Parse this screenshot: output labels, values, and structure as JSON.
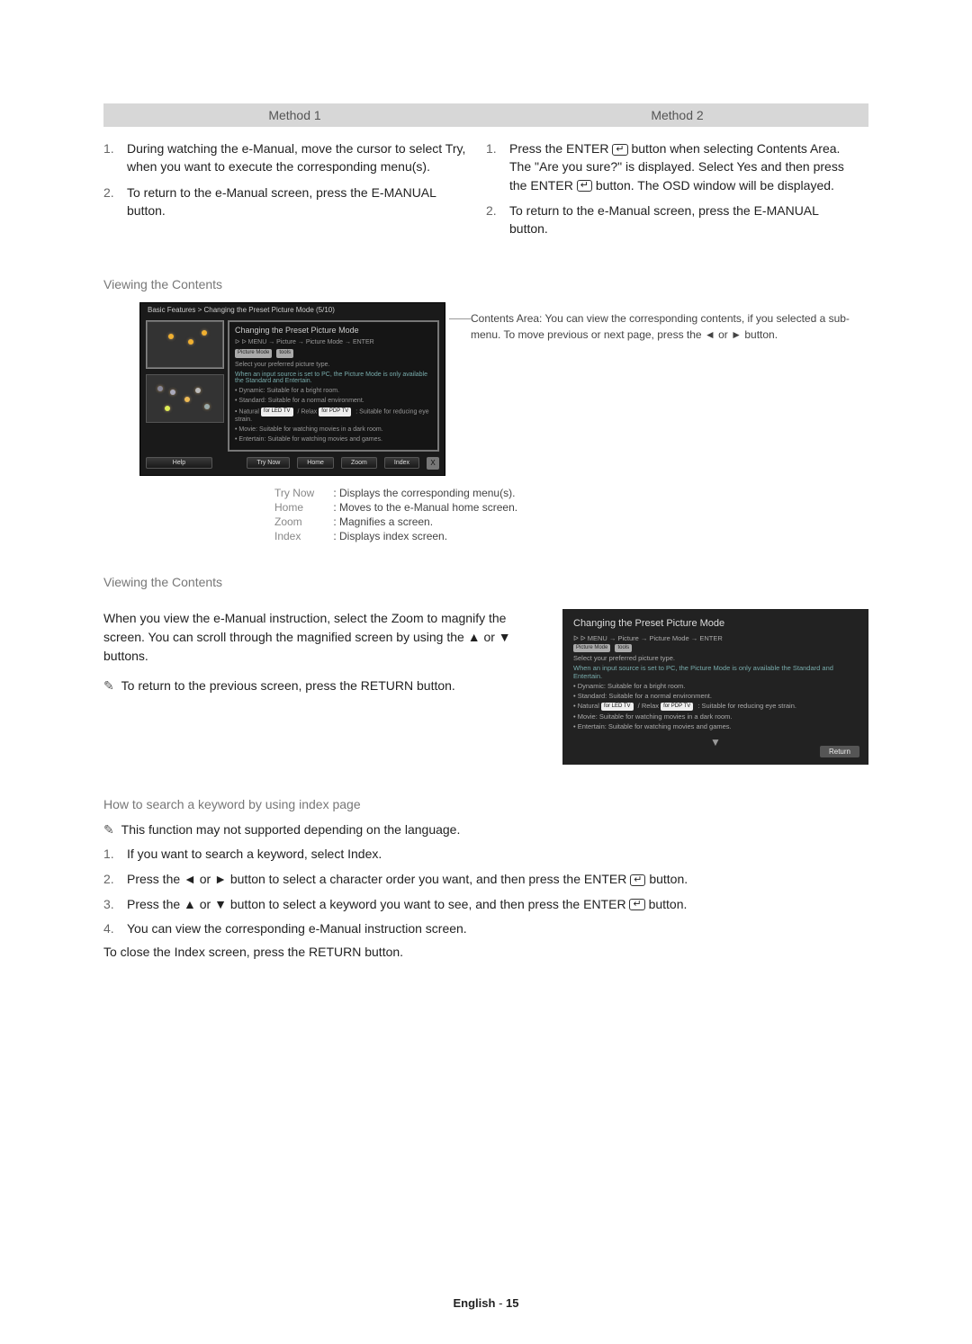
{
  "methods_header": {
    "m1": "Method 1",
    "m2": "Method 2"
  },
  "method1": {
    "s1": "During watching the e-Manual, move the cursor to select Try, when you want to execute the corresponding menu(s).",
    "s2": "To return to the e-Manual screen, press the E-MANUAL button."
  },
  "method2": {
    "s1a": "Press the ",
    "s1b": "ENTER",
    "s1c": " button when selecting Contents Area. The \"Are you sure?\" is displayed. Select Yes and then press the ",
    "s1d": "ENTER",
    "s1e": " button. The OSD window will be displayed.",
    "s2": "To return to the e-Manual screen, press the E-MANUAL button."
  },
  "section_viewing": "Viewing the Contents",
  "emanual": {
    "breadcrumb": "Basic Features > Changing the Preset Picture Mode (5/10)",
    "content_title": "Changing the Preset Picture Mode",
    "sub_row": "ᐅ   ᐅ   MENU  → Picture → Picture Mode → ENTER",
    "badge1": "Picture Mode",
    "badge2": "tools",
    "line1": "Select your preferred picture type.",
    "note1": "When an input source is set to PC, the Picture Mode is only available the Standard and Entertain.",
    "b1": "Dynamic: Suitable for a bright room.",
    "b2": "Standard: Suitable for a normal environment.",
    "b3a": "Natural ",
    "led_badge": "for LED TV",
    "b3b": " / Relax ",
    "pdp_badge": "for PDP TV",
    "b3c": ": Suitable for reducing eye strain.",
    "b4": "Movie: Suitable for watching movies in a dark room.",
    "b5": "Entertain: Suitable for watching movies and games.",
    "toolbar": {
      "help": "Help",
      "trynow": "Try Now",
      "home": "Home",
      "zoom": "Zoom",
      "index": "Index",
      "close": "X"
    }
  },
  "callout_text": "Contents Area: You can view the corresponding contents, if you selected a sub-menu. To move previous or next page, press the ◄ or ► button.",
  "legend": {
    "trynow_label": "Try Now",
    "trynow_text": ": Displays the corresponding menu(s).",
    "home_label": "Home",
    "home_text": ": Moves to the e-Manual home screen.",
    "zoom_label": "Zoom",
    "zoom_text": ": Magnifies a screen.",
    "index_label": "Index",
    "index_text": ": Displays index screen."
  },
  "section_zoom": "Viewing the Contents",
  "zoom_text_main": "When you view the e-Manual instruction, select the Zoom to magnify the screen. You can scroll through the magnified screen by using the ▲ or ▼ buttons.",
  "zoom_note": "To return to the previous screen, press the RETURN button.",
  "zoom_panel": {
    "title": "Changing the Preset Picture Mode",
    "sub": "ᐅ   ᐅ   MENU  → Picture → Picture Mode → ENTER",
    "badge": "Picture Mode",
    "tools": "tools",
    "l1": "Select your preferred picture type.",
    "l2": "When an input source is set to PC, the Picture Mode is only available the Standard and Entertain.",
    "b1": "Dynamic: Suitable for a bright room.",
    "b2": "Standard: Suitable for a normal environment.",
    "b3a": "Natural ",
    "b3b": " / Relax ",
    "b3c": ": Suitable for reducing eye strain.",
    "b4": "Movie: Suitable for watching movies in a dark room.",
    "b5": "Entertain: Suitable for watching movies and games.",
    "return": "Return"
  },
  "section_howto": "How to search a keyword by using index page",
  "howto_note": "This function may not supported depending on the language.",
  "howto_steps": {
    "s1": "If you want to search a keyword, select Index.",
    "s2a": "Press the ◄ or ► button to select a character order you want, and then press the ",
    "s2b": "ENTER",
    "s2c": " button.",
    "s3a": "Press the ▲ or ▼ button to select a keyword you want to see, and then press the ",
    "s3b": "ENTER",
    "s3c": " button.",
    "s4": "You can view the corresponding e-Manual instruction screen."
  },
  "howto_close": "To close the Index screen, press the RETURN button.",
  "footer": {
    "lang": "English",
    "sep": " - ",
    "page": "15"
  }
}
